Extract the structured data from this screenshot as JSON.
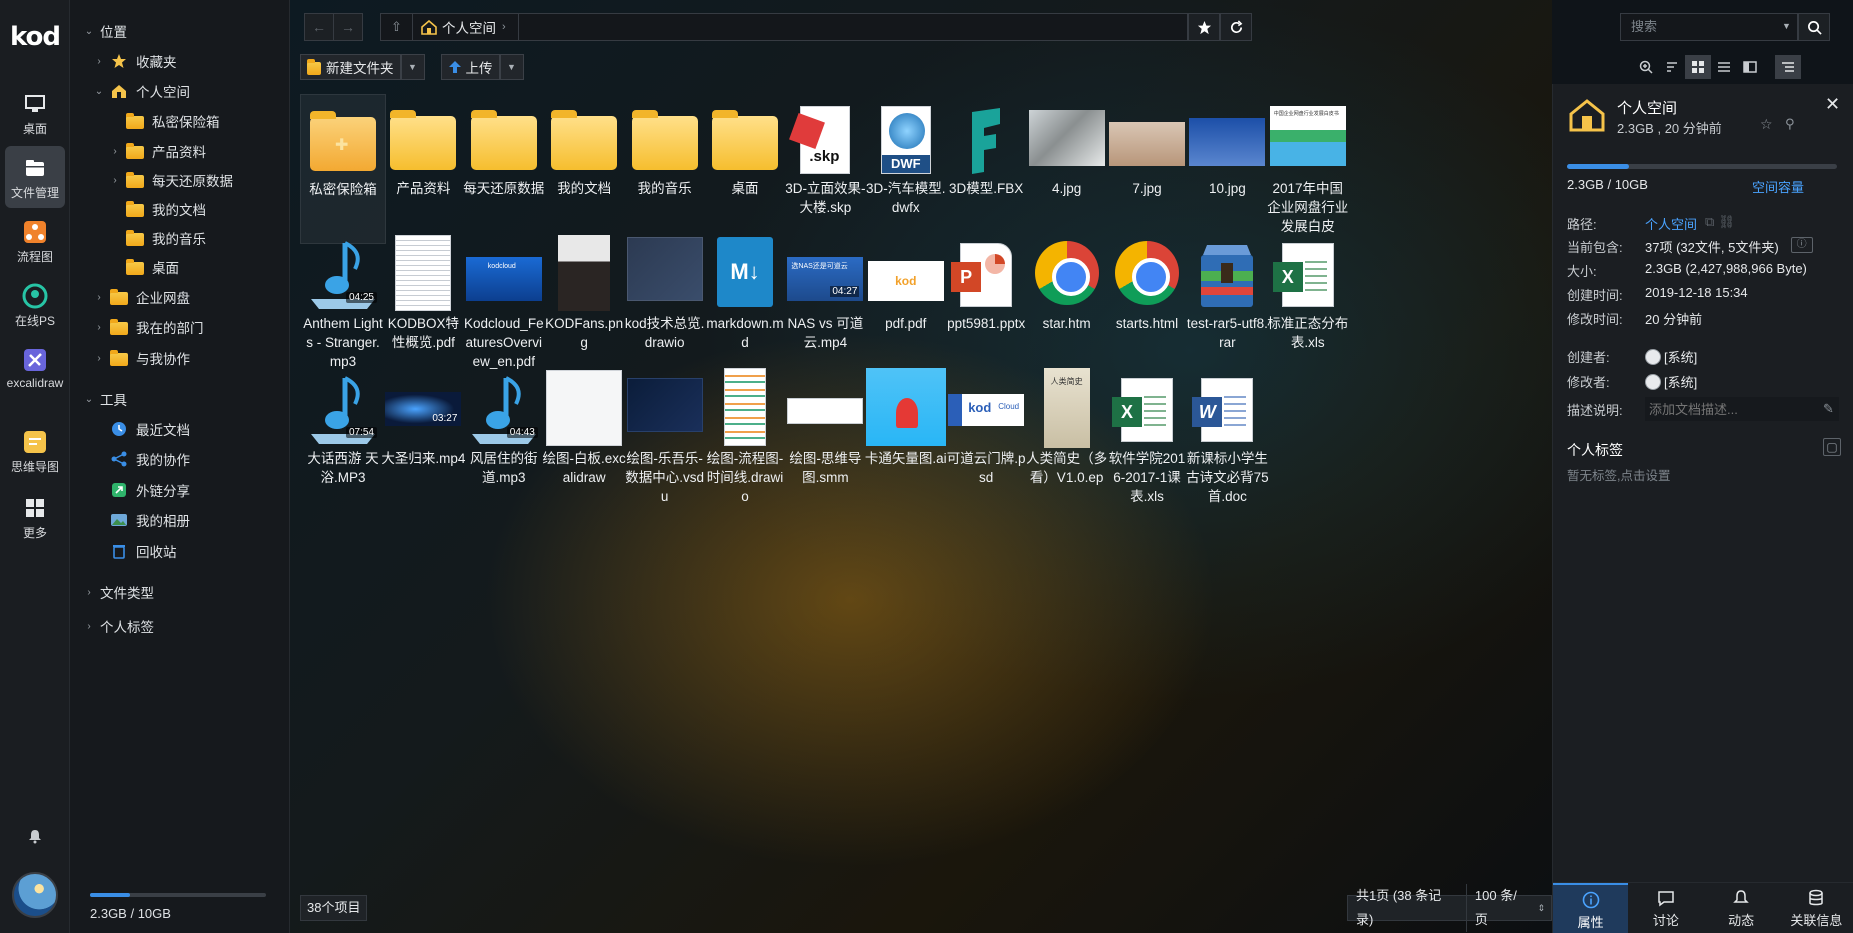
{
  "app": {
    "logo": "kod"
  },
  "rail": [
    {
      "label": "桌面",
      "icon": "monitor-icon"
    },
    {
      "label": "文件管理",
      "icon": "folder-manager-icon",
      "active": true
    },
    {
      "label": "流程图",
      "icon": "flowchart-icon"
    },
    {
      "label": "在线PS",
      "icon": "photoshop-icon"
    },
    {
      "label": "excalidraw",
      "icon": "excalidraw-icon"
    },
    {
      "label": "思维导图",
      "icon": "mindmap-icon"
    },
    {
      "label": "更多",
      "icon": "grid-icon"
    }
  ],
  "tree": {
    "location": "位置",
    "favorites": "收藏夹",
    "personal": "个人空间",
    "personal_children": [
      "私密保险箱",
      "产品资料",
      "每天还原数据",
      "我的文档",
      "我的音乐",
      "桌面"
    ],
    "enterprise": "企业网盘",
    "my_dept": "我在的部门",
    "collab": "与我协作",
    "tools": "工具",
    "tool_items": [
      "最近文档",
      "我的协作",
      "外链分享",
      "我的相册",
      "回收站"
    ],
    "file_types": "文件类型",
    "personal_tags": "个人标签",
    "quota": "2.3GB / 10GB",
    "quota_fraction": 0.23
  },
  "topbar": {
    "crumb": "个人空间",
    "search_placeholder": "搜索"
  },
  "toolbar": {
    "new_folder": "新建文件夹",
    "upload": "上传"
  },
  "files": [
    {
      "name": "私密保险箱",
      "kind": "folder-safe"
    },
    {
      "name": "产品资料",
      "kind": "folder"
    },
    {
      "name": "每天还原数据",
      "kind": "folder"
    },
    {
      "name": "我的文档",
      "kind": "folder"
    },
    {
      "name": "我的音乐",
      "kind": "folder"
    },
    {
      "name": "桌面",
      "kind": "folder"
    },
    {
      "name": "3D-立面效果-大楼.skp",
      "kind": "skp",
      "badge": ".skp"
    },
    {
      "name": "3D-汽车模型.dwfx",
      "kind": "dwf",
      "badge": "DWF"
    },
    {
      "name": "3D模型.FBX",
      "kind": "fbx"
    },
    {
      "name": "4.jpg",
      "kind": "img-cat"
    },
    {
      "name": "7.jpg",
      "kind": "img-beach"
    },
    {
      "name": "10.jpg",
      "kind": "img-sky"
    },
    {
      "name": "2017年中国企业网盘行业发展白皮",
      "kind": "img-report",
      "thumb_title": "中国企业网盘行业发展白皮书"
    },
    {
      "name": "Anthem Lights - Stranger.mp3",
      "kind": "audio",
      "duration": "04:25"
    },
    {
      "name": "KODBOX特性概览.pdf",
      "kind": "pdf-doc"
    },
    {
      "name": "Kodcloud_FeaturesOverview_en.pdf",
      "kind": "img-blue",
      "thumb_title": "kodcloud"
    },
    {
      "name": "KODFans.png",
      "kind": "img-person"
    },
    {
      "name": "kod技术总览.drawio",
      "kind": "img-dark"
    },
    {
      "name": "markdown.md",
      "kind": "md",
      "badge": "M↓"
    },
    {
      "name": "NAS vs 可道云.mp4",
      "kind": "video-nas",
      "duration": "04:27",
      "thumb_title": "选NAS还是可道云"
    },
    {
      "name": "pdf.pdf",
      "kind": "img-kod",
      "thumb_title": "kod"
    },
    {
      "name": "ppt5981.pptx",
      "kind": "ppt",
      "badge": "P"
    },
    {
      "name": "star.htm",
      "kind": "chrome"
    },
    {
      "name": "starts.html",
      "kind": "chrome"
    },
    {
      "name": "test-rar5-utf8.rar",
      "kind": "rar"
    },
    {
      "name": "标准正态分布表.xls",
      "kind": "xls",
      "badge": "X"
    },
    {
      "name": "大话西游 天浴.MP3",
      "kind": "audio",
      "duration": "07:54"
    },
    {
      "name": "大圣归来.mp4",
      "kind": "video-dark",
      "duration": "03:27"
    },
    {
      "name": "风居住的街道.mp3",
      "kind": "audio",
      "duration": "04:43"
    },
    {
      "name": "绘图-白板.excalidraw",
      "kind": "img-white"
    },
    {
      "name": "绘图-乐吾乐-数据中心.vsdu",
      "kind": "img-iso"
    },
    {
      "name": "绘图-流程图-时间线.drawio",
      "kind": "img-timeline"
    },
    {
      "name": "绘图-思维导图.smm",
      "kind": "img-mind"
    },
    {
      "name": "卡通矢量图.ai",
      "kind": "img-cartoon"
    },
    {
      "name": "可道云门牌.psd",
      "kind": "img-sign",
      "thumb_title": "kod",
      "thumb_sub": "Cloud"
    },
    {
      "name": "人类简史（多看）V1.0.ep",
      "kind": "img-book",
      "thumb_title": "人类简史"
    },
    {
      "name": "软件学院2016-2017-1课表.xls",
      "kind": "xls",
      "badge": "X"
    },
    {
      "name": "新课标小学生古诗文必背75首.doc",
      "kind": "doc",
      "badge": "W"
    }
  ],
  "status": {
    "count": "38个项目",
    "pages": "共1页 (38 条记录)",
    "per_page": "100 条/页"
  },
  "panel": {
    "title": "个人空间",
    "subtitle": "2.3GB , 20 分钟前",
    "used": "2.3GB / 10GB",
    "used_fraction": 0.23,
    "capacity_link": "空间容量",
    "props": [
      {
        "k": "路径:",
        "v": "个人空间",
        "link": true
      },
      {
        "k": "当前包含:",
        "v": "37项 (32文件, 5文件夹)"
      },
      {
        "k": "大小:",
        "v": "2.3GB (2,427,988,966 Byte)"
      },
      {
        "k": "创建时间:",
        "v": "2019-12-18 15:34"
      },
      {
        "k": "修改时间:",
        "v": "20 分钟前"
      },
      {
        "k": "创建者:",
        "v": "[系统]",
        "user": true
      },
      {
        "k": "修改者:",
        "v": "[系统]",
        "user": true
      },
      {
        "k": "描述说明:",
        "v": ""
      }
    ],
    "desc_placeholder": "添加文档描述...",
    "tags_title": "个人标签",
    "tags_hint": "暂无标签,点击设置",
    "tabs": [
      "属性",
      "讨论",
      "动态",
      "关联信息"
    ]
  }
}
